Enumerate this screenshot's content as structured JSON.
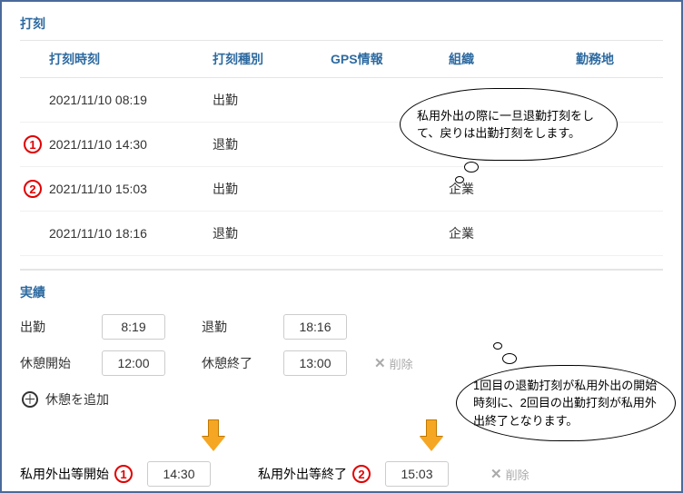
{
  "sections": {
    "timestamps_title": "打刻",
    "results_title": "実績"
  },
  "headers": {
    "time": "打刻時刻",
    "type": "打刻種別",
    "gps": "GPS情報",
    "org": "組織",
    "place": "勤務地"
  },
  "rows": [
    {
      "marker": "",
      "time": "2021/11/10 08:19",
      "type": "出勤",
      "org": ""
    },
    {
      "marker": "1",
      "time": "2021/11/10 14:30",
      "type": "退勤",
      "org": ""
    },
    {
      "marker": "2",
      "time": "2021/11/10 15:03",
      "type": "出勤",
      "org": "企業"
    },
    {
      "marker": "",
      "time": "2021/11/10 18:16",
      "type": "退勤",
      "org": "企業"
    }
  ],
  "results": {
    "checkin_label": "出勤",
    "checkin_value": "8:19",
    "checkout_label": "退勤",
    "checkout_value": "18:16",
    "break_start_label": "休憩開始",
    "break_start_value": "12:00",
    "break_end_label": "休憩終了",
    "break_end_value": "13:00",
    "delete_label": "削除",
    "add_break_label": "休憩を追加",
    "private_start_label": "私用外出等開始",
    "private_start_value": "14:30",
    "private_end_label": "私用外出等終了",
    "private_end_value": "15:03"
  },
  "markers": {
    "one": "1",
    "two": "2"
  },
  "bubbles": {
    "b1": "私用外出の際に一旦退勤打刻をして、戻りは出勤打刻をします。",
    "b2": "1回目の退勤打刻が私用外出の開始時刻に、2回目の出勤打刻が私用外出終了となります。"
  }
}
